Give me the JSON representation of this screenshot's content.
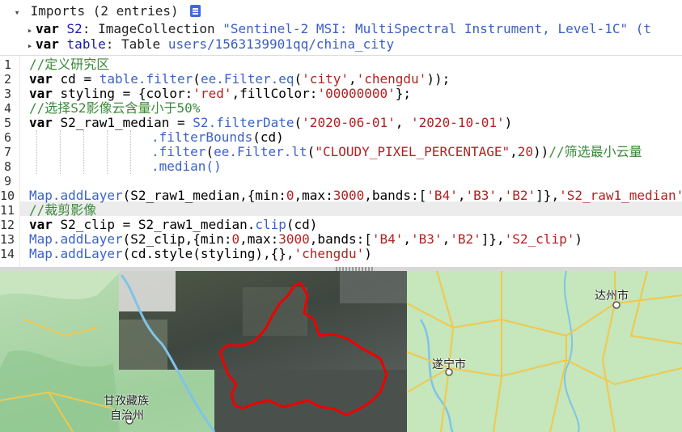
{
  "imports": {
    "header": "Imports (2 entries)",
    "rows": [
      {
        "keyword": "var",
        "name": "S2",
        "colon": ":",
        "type": "ImageCollection",
        "value": "\"Sentinel-2 MSI: MultiSpectral Instrument, Level-1C\" (t"
      },
      {
        "keyword": "var",
        "name": "table",
        "colon": ":",
        "type": "Table",
        "value": "users/1563139901qq/china_city"
      }
    ]
  },
  "editor": {
    "line_numbers": [
      "1",
      "2",
      "3",
      "4",
      "5",
      "6",
      "7",
      "8",
      "9",
      "10",
      "11",
      "12",
      "13",
      "14"
    ],
    "highlighted_line": "11",
    "lines": {
      "l1": "//定义研究区",
      "l2_kw": "var",
      "l2_a": " cd = ",
      "l2_b": "table.filter",
      "l2_c": "(",
      "l2_d": "ee.Filter.eq",
      "l2_e": "(",
      "l2_f": "'city'",
      "l2_g": ",",
      "l2_h": "'chengdu'",
      "l2_i": "));",
      "l3_kw": "var",
      "l3_a": " styling = {color:",
      "l3_b": "'red'",
      "l3_c": ",fillColor:",
      "l3_d": "'00000000'",
      "l3_e": "};",
      "l4": "//选择S2影像云含量小于50%",
      "l5_kw": "var",
      "l5_a": " S2_raw1_median = ",
      "l5_b": "S2.filterDate",
      "l5_c": "(",
      "l5_d": "'2020-06-01'",
      "l5_e": ", ",
      "l5_f": "'2020-10-01'",
      "l5_g": ")",
      "l6_a": ".filterBounds",
      "l6_b": "(cd)",
      "l7_a": ".filter",
      "l7_b": "(",
      "l7_c": "ee.Filter.lt",
      "l7_d": "(",
      "l7_e": "\"CLOUDY_PIXEL_PERCENTAGE\"",
      "l7_f": ",",
      "l7_g": "20",
      "l7_h": "))",
      "l7_i": "//筛选最小云量",
      "l8": ".median()",
      "l10_a": "Map.addLayer",
      "l10_b": "(S2_raw1_median,{min:",
      "l10_c": "0",
      "l10_d": ",max:",
      "l10_e": "3000",
      "l10_f": ",bands:[",
      "l10_g": "'B4'",
      "l10_h": ",",
      "l10_i": "'B3'",
      "l10_j": ",",
      "l10_k": "'B2'",
      "l10_l": "]},",
      "l10_m": "'S2_raw1_median'",
      "l10_n": ")",
      "l11": "//裁剪影像",
      "l12_kw": "var",
      "l12_a": " S2_clip = S2_raw1_median.",
      "l12_b": "clip",
      "l12_c": "(cd)",
      "l13_a": "Map.addLayer",
      "l13_b": "(S2_clip,{min:",
      "l13_c": "0",
      "l13_d": ",max:",
      "l13_e": "3000",
      "l13_f": ",bands:[",
      "l13_g": "'B4'",
      "l13_h": ",",
      "l13_i": "'B3'",
      "l13_j": ",",
      "l13_k": "'B2'",
      "l13_l": "]},",
      "l13_m": "'S2_clip'",
      "l13_n": ")",
      "l14_a": "Map.addLayer",
      "l14_b": "(cd.style(styling),{},",
      "l14_c": "'chengdu'",
      "l14_d": ")"
    }
  },
  "map": {
    "labels": {
      "dazhou": "达州市",
      "suining": "遂宁市",
      "ganzi_1": "甘孜藏族",
      "ganzi_2": "自治州"
    },
    "colors": {
      "terrain": "#a9d4a5",
      "plain": "#c3e4b8",
      "river": "#7ec4e9",
      "road": "#f2c84b",
      "boundary": "#ee0000"
    }
  }
}
